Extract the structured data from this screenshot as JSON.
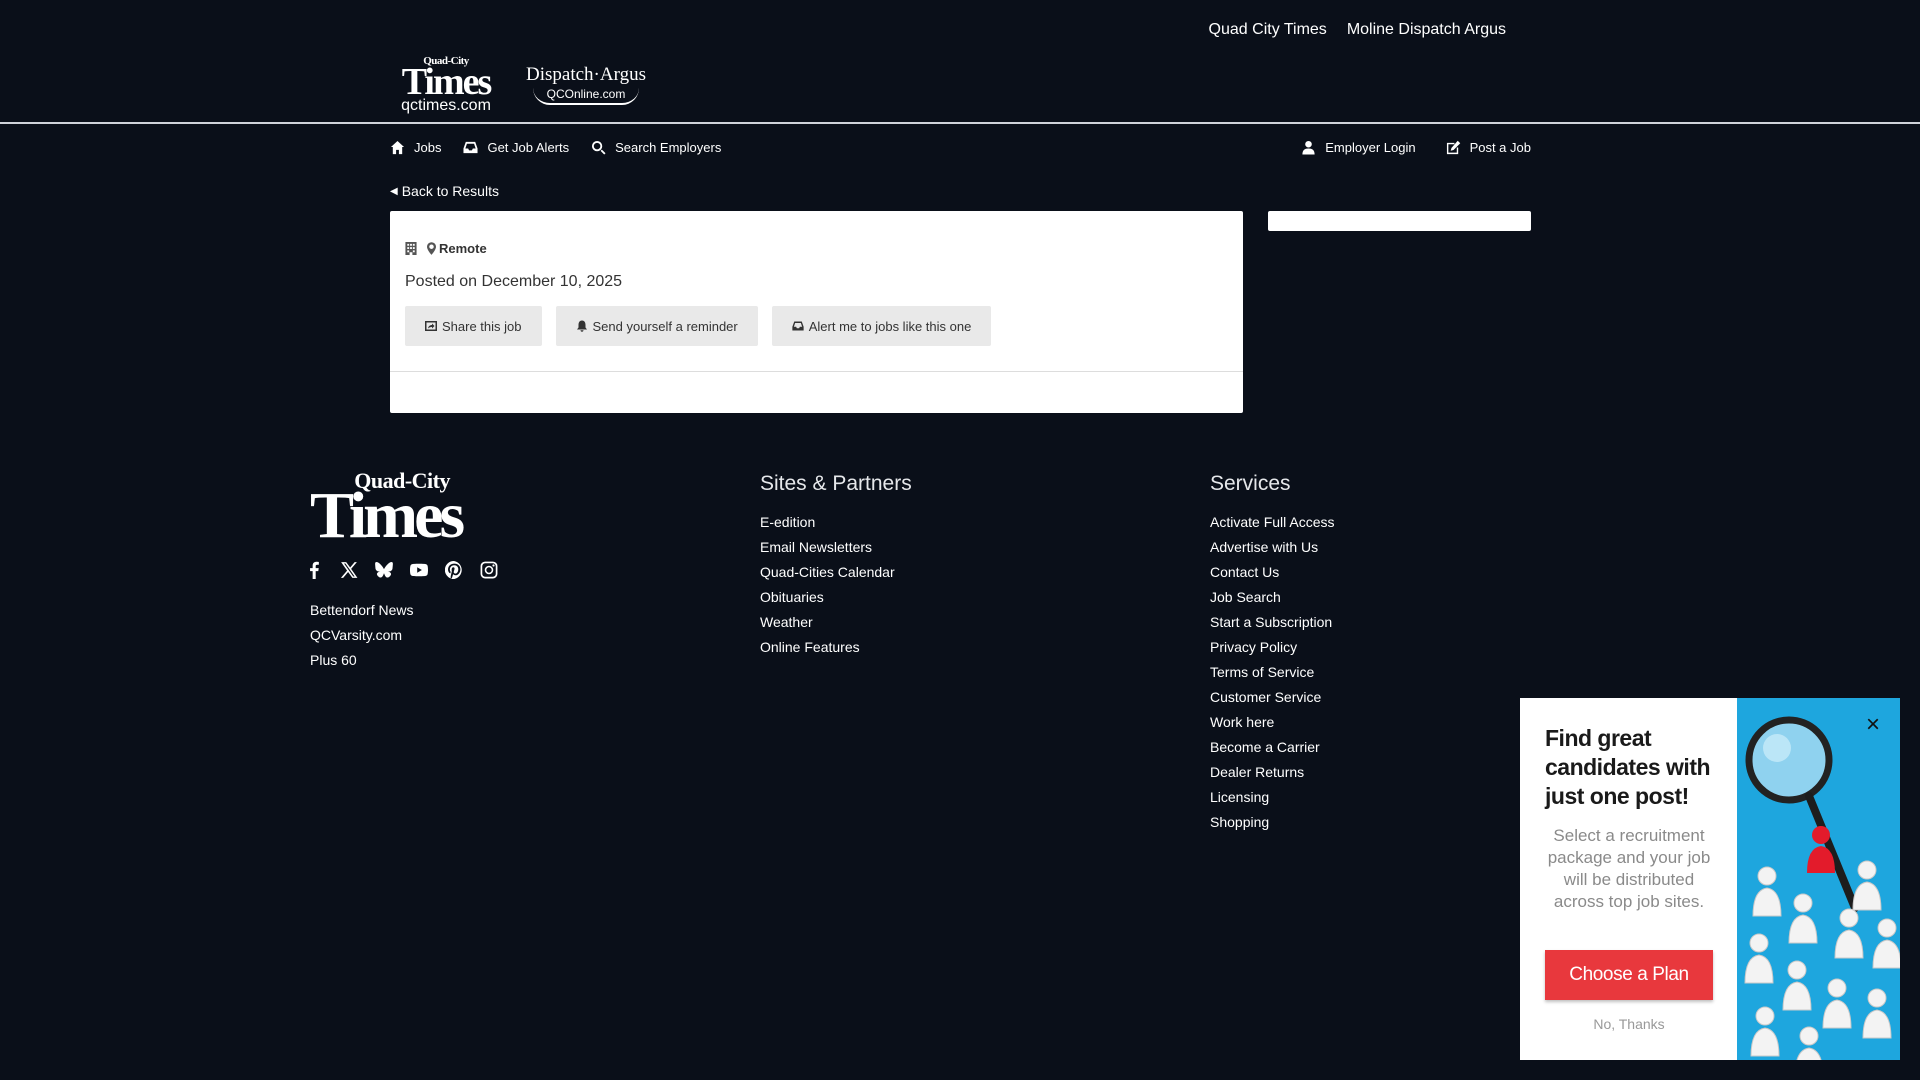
{
  "header": {
    "top_links": [
      "Quad City Times",
      "Moline Dispatch Argus"
    ],
    "logo_qct": {
      "line1": "Quad-City",
      "line2": "Times",
      "site": "qctimes.com"
    },
    "logo_da": {
      "name": "Dispatch·Argus",
      "site": "QCOnline.com"
    }
  },
  "nav": {
    "left": [
      {
        "label": "Jobs",
        "icon": "home-icon"
      },
      {
        "label": "Get Job Alerts",
        "icon": "inbox-icon"
      },
      {
        "label": "Search Employers",
        "icon": "search-icon"
      }
    ],
    "right": [
      {
        "label": "Employer Login",
        "icon": "user-icon"
      },
      {
        "label": "Post a Job",
        "icon": "edit-icon"
      }
    ]
  },
  "back_link": "Back to Results",
  "job": {
    "location": "Remote",
    "posted_prefix": "Posted on",
    "posted_date": "December 10, 2025",
    "actions": {
      "share": "Share this job",
      "reminder": "Send yourself a reminder",
      "alert": "Alert me to jobs like this one"
    }
  },
  "footer": {
    "logo": {
      "line1": "Quad-City",
      "line2": "Times"
    },
    "social_icons": [
      "facebook-icon",
      "x-icon",
      "bluesky-icon",
      "youtube-icon",
      "pinterest-icon",
      "instagram-icon"
    ],
    "misc_links": [
      "Bettendorf News",
      "QCVarsity.com",
      "Plus 60"
    ],
    "sites_partners": {
      "title": "Sites & Partners",
      "links": [
        "E-edition",
        "Email Newsletters",
        "Quad-Cities Calendar",
        "Obituaries",
        "Weather",
        "Online Features"
      ]
    },
    "services": {
      "title": "Services",
      "links": [
        "Activate Full Access",
        "Advertise with Us",
        "Contact Us",
        "Job Search",
        "Start a Subscription",
        "Privacy Policy",
        "Terms of Service",
        "Customer Service",
        "Work here",
        "Become a Carrier",
        "Dealer Returns",
        "Licensing",
        "Shopping"
      ]
    }
  },
  "popup": {
    "title": "Find great candidates with just one post!",
    "body": "Select a recruitment package and your job will be distributed across top job sites.",
    "cta": "Choose a Plan",
    "dismiss": "No, Thanks",
    "close": "×"
  },
  "colors": {
    "background": "#0a0f19",
    "cta": "#e8383d",
    "popup_image": "#1ea6de"
  }
}
